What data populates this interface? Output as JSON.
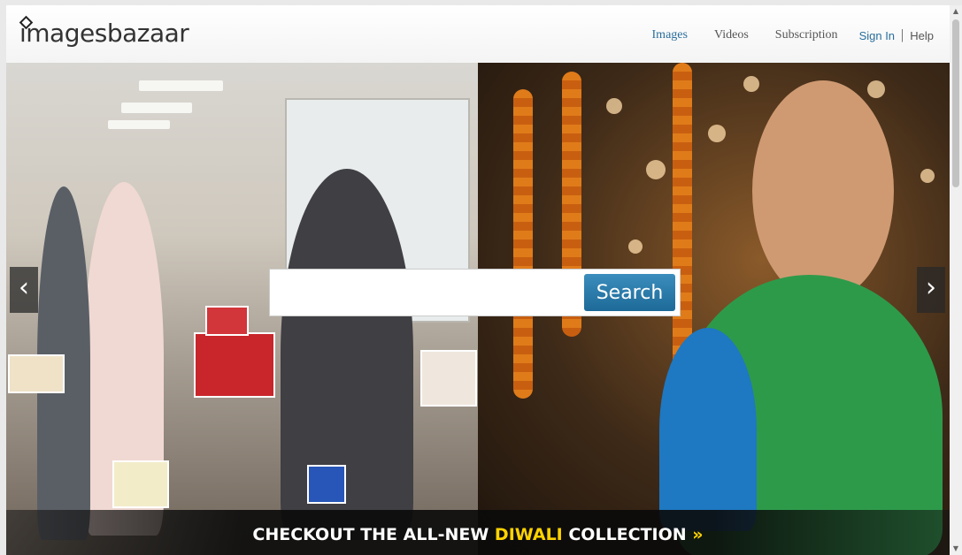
{
  "header": {
    "logo_main": "images",
    "logo_rest": "bazaar",
    "nav": [
      {
        "label": "Images",
        "active": true
      },
      {
        "label": "Videos",
        "active": false
      },
      {
        "label": "Subscription",
        "active": false
      }
    ],
    "sign_in": "Sign In",
    "separator": "|",
    "help": "Help"
  },
  "search": {
    "value": "",
    "placeholder": "",
    "button_label": "Search"
  },
  "carousel": {
    "prev_glyph": "‹",
    "next_glyph": "›"
  },
  "banner": {
    "part1": "CHECKOUT THE ALL-NEW ",
    "highlight": "DIWALI",
    "part2": " COLLECTION ",
    "chevrons": "»"
  },
  "colors": {
    "accent": "#2a6e9c",
    "search_button": "#1d6a98",
    "banner_highlight": "#ffd200"
  }
}
